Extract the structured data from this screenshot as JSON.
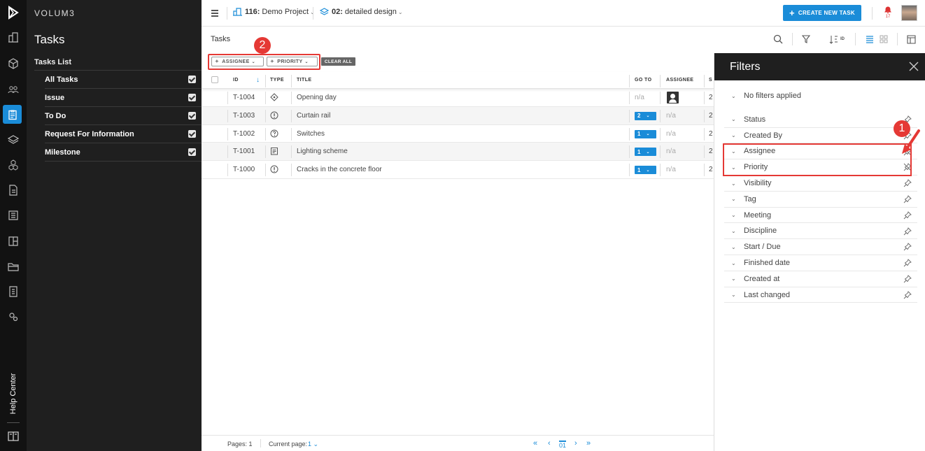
{
  "app": {
    "brand": "VOLUM3"
  },
  "rail": {
    "icons": [
      "logo-icon",
      "buildings-icon",
      "box-icon",
      "people-icon",
      "clipboard-icon",
      "layers-icon",
      "cubes-icon",
      "document-icon",
      "list-icon",
      "panel-icon",
      "folder-icon",
      "sheet-icon",
      "settings-icon"
    ],
    "help_label": "Help Center"
  },
  "sidebar": {
    "title": "Tasks",
    "list_label": "Tasks List",
    "items": [
      {
        "label": "All Tasks",
        "checked": true
      },
      {
        "label": "Issue",
        "checked": true
      },
      {
        "label": "To Do",
        "checked": true
      },
      {
        "label": "Request For Information",
        "checked": true
      },
      {
        "label": "Milestone",
        "checked": true
      }
    ]
  },
  "topbar": {
    "project_number": "116:",
    "project_name": "Demo Project",
    "design_number": "02:",
    "design_name": "detailed design",
    "create_label": "CREATE NEW TASK",
    "notifications_count": "17"
  },
  "toolbar": {
    "title": "Tasks",
    "sort_label": "ID"
  },
  "filters_bar": {
    "chips": [
      "ASSIGNEE",
      "PRIORITY"
    ],
    "clear_label": "CLEAR ALL",
    "badge": "2"
  },
  "table": {
    "headers": {
      "id": "ID",
      "type": "TYPE",
      "title": "TITLE",
      "goto": "GO TO",
      "assignee": "ASSIGNEE",
      "s": "S"
    },
    "rows": [
      {
        "id": "T-1004",
        "type": "milestone",
        "title": "Opening day",
        "goto": "n/a",
        "assignee": "avatar",
        "s": "2"
      },
      {
        "id": "T-1003",
        "type": "issue",
        "title": "Curtain rail",
        "goto": "2",
        "assignee": "n/a",
        "s": "2"
      },
      {
        "id": "T-1002",
        "type": "rfi",
        "title": "Switches",
        "goto": "1",
        "assignee": "n/a",
        "s": "2"
      },
      {
        "id": "T-1001",
        "type": "todo",
        "title": "Lighting scheme",
        "goto": "1",
        "assignee": "n/a",
        "s": "2"
      },
      {
        "id": "T-1000",
        "type": "issue",
        "title": "Cracks in the concrete floor",
        "goto": "1",
        "assignee": "n/a",
        "s": "2"
      }
    ]
  },
  "footer": {
    "pages_label": "Pages: 1",
    "current_label": "Current page:",
    "current_value": "1",
    "page": "01"
  },
  "filters_panel": {
    "title": "Filters",
    "summary": "No filters applied",
    "items": [
      "Status",
      "Created By",
      "Assignee",
      "Priority",
      "Visibility",
      "Tag",
      "Meeting",
      "Discipline",
      "Start / Due",
      "Finished date",
      "Created at",
      "Last changed"
    ],
    "badge": "1"
  },
  "colors": {
    "accent": "#1a8cd8",
    "highlight": "#e53935",
    "dark": "#1f1f1f"
  }
}
